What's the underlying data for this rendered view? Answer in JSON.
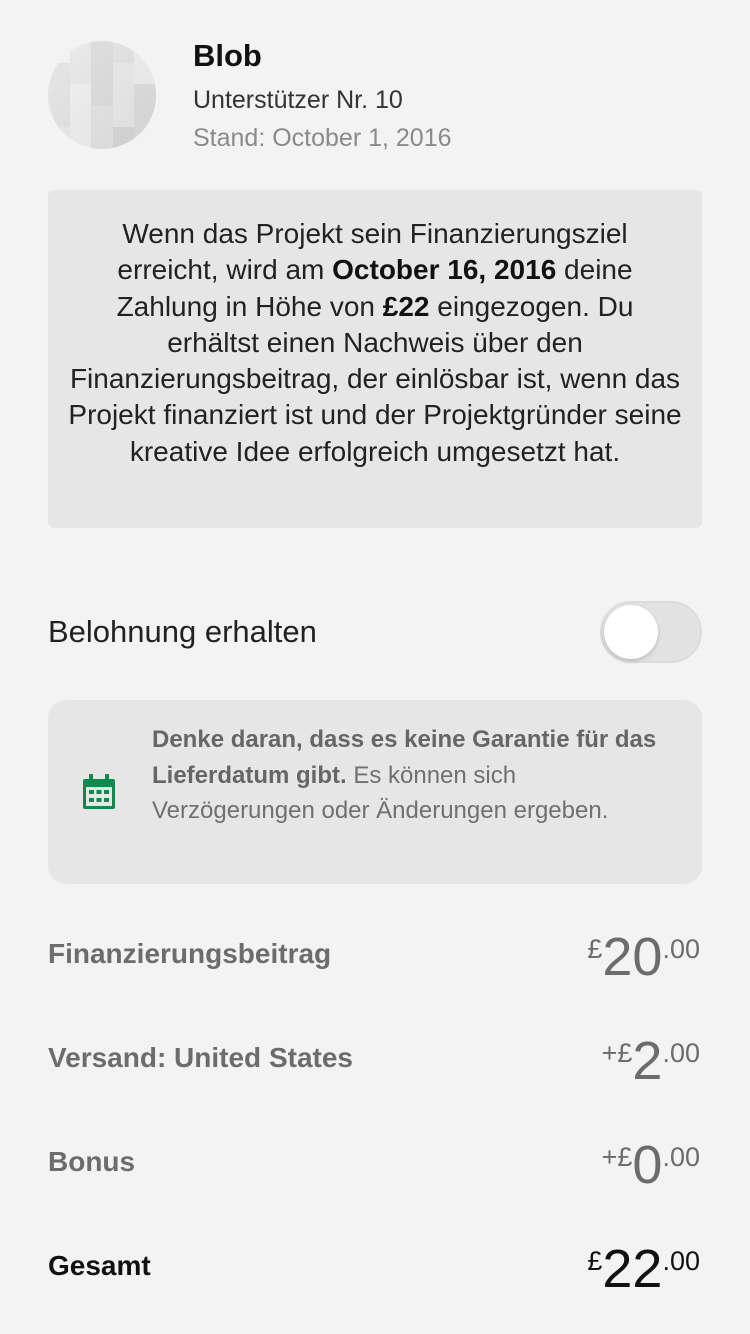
{
  "backer": {
    "name": "Blob",
    "number_text": "Unterstützer Nr. 10",
    "as_of_text": "Stand: October 1, 2016"
  },
  "info": {
    "part1": "Wenn das Projekt sein Finanzierungsziel erreicht, wird am ",
    "date": "October 16, 2016",
    "part2": " deine Zahlung in Höhe von ",
    "amount": "£22",
    "part3": " eingezogen. Du erhältst einen Nachweis über den Finanzierungsbeitrag, der einlösbar ist, wenn das Projekt finanziert ist und der Projektgründer seine kreative Idee erfolgreich umgesetzt hat."
  },
  "reward": {
    "label": "Belohnung erhalten",
    "toggle_on": false
  },
  "delivery_note": {
    "icon": "calendar-icon",
    "bold": "Denke daran, dass es keine Garantie für das Lieferdatum gibt.",
    "rest": " Es können sich Verzögerungen oder Änderungen ergeben."
  },
  "summary": {
    "pledge": {
      "label": "Finanzierungsbeitrag",
      "prefix": "£",
      "int": "20",
      "dec": ".00"
    },
    "shipping": {
      "label": "Versand: United States",
      "prefix": "+£",
      "int": "2",
      "dec": ".00"
    },
    "bonus": {
      "label": "Bonus",
      "prefix": "+£",
      "int": "0",
      "dec": ".00"
    },
    "total": {
      "label": "Gesamt",
      "prefix": "£",
      "int": "22",
      "dec": ".00"
    }
  },
  "colors": {
    "background": "#f3f3f3",
    "box": "#e6e6e6",
    "calendar_green": "#0f8a4f"
  }
}
